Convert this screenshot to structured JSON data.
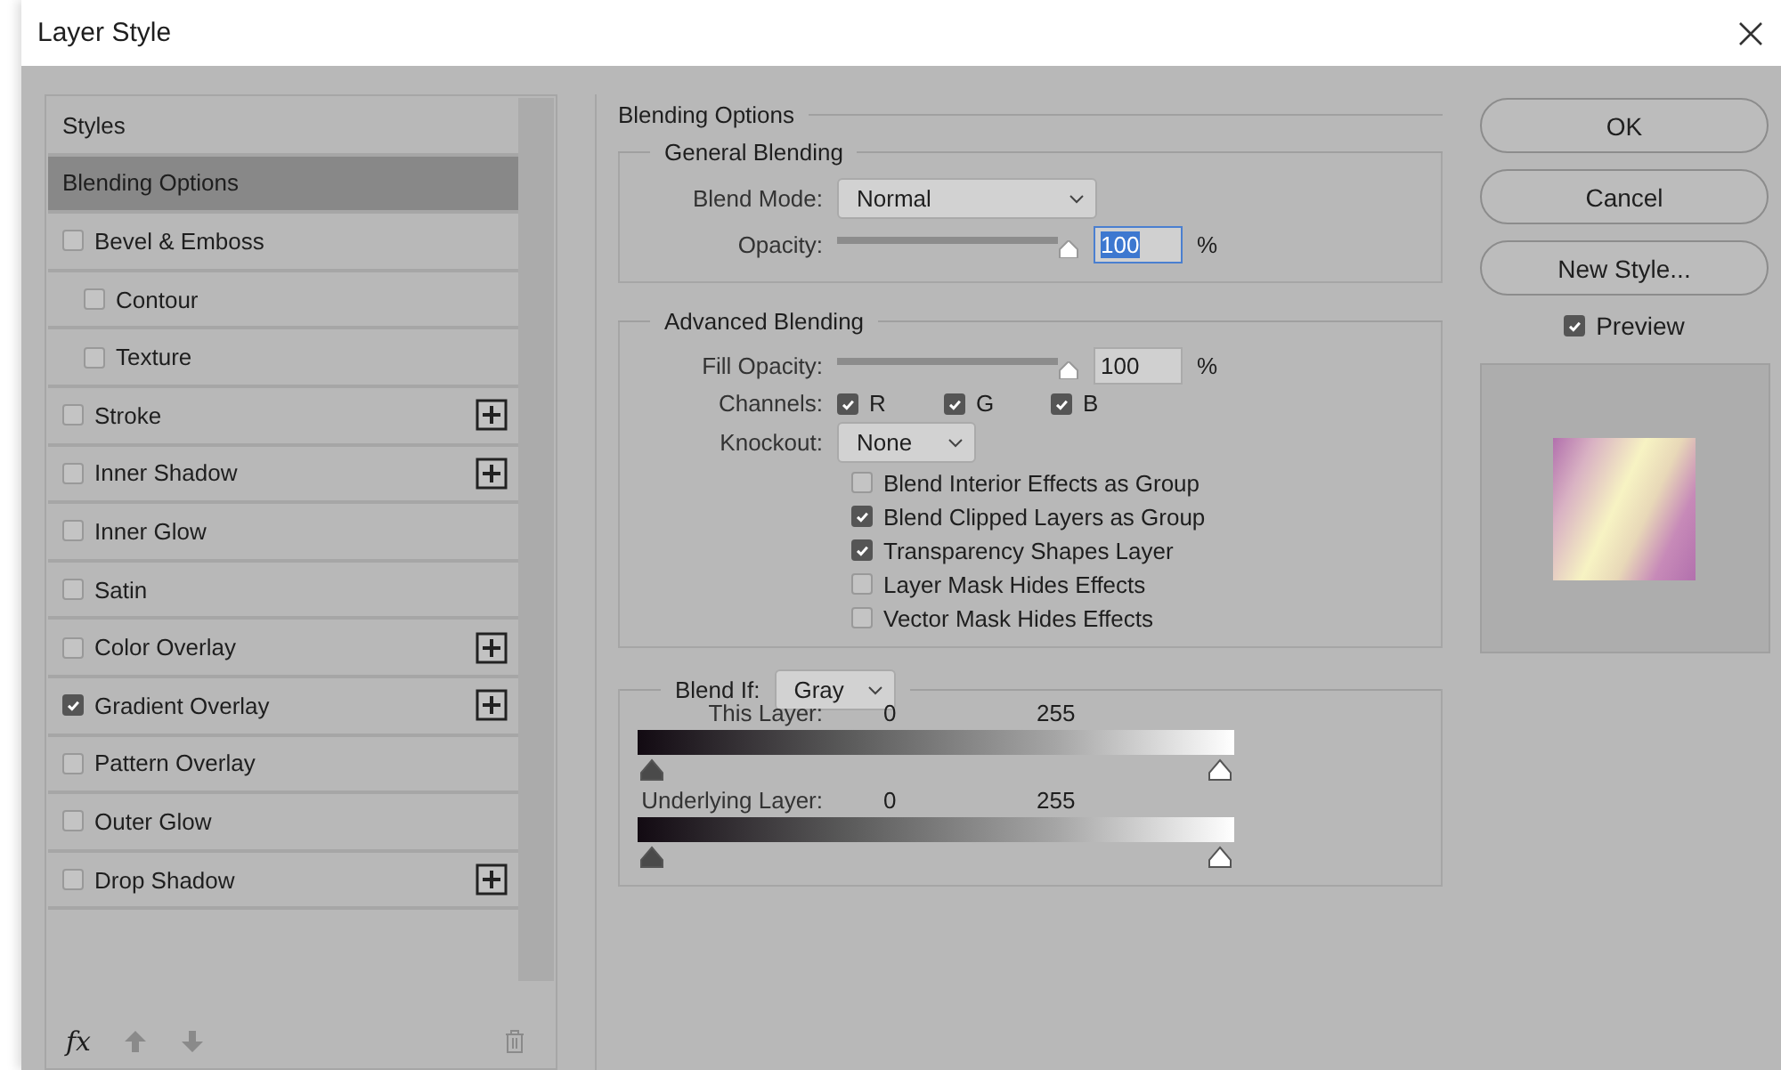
{
  "window": {
    "title": "Layer Style"
  },
  "sidebar": {
    "items": [
      {
        "label": "Styles",
        "kind": "header",
        "selected": false
      },
      {
        "label": "Blending Options",
        "kind": "header",
        "selected": true
      },
      {
        "label": "Bevel & Emboss",
        "kind": "effect",
        "checked": false,
        "selected": false,
        "add_button": false,
        "children": [
          {
            "label": "Contour",
            "kind": "effect",
            "checked": false,
            "selected": false,
            "add_button": false
          },
          {
            "label": "Texture",
            "kind": "effect",
            "checked": false,
            "selected": false,
            "add_button": false
          }
        ]
      },
      {
        "label": "Stroke",
        "kind": "effect",
        "checked": false,
        "selected": false,
        "add_button": true
      },
      {
        "label": "Inner Shadow",
        "kind": "effect",
        "checked": false,
        "selected": false,
        "add_button": true
      },
      {
        "label": "Inner Glow",
        "kind": "effect",
        "checked": false,
        "selected": false,
        "add_button": false
      },
      {
        "label": "Satin",
        "kind": "effect",
        "checked": false,
        "selected": false,
        "add_button": false
      },
      {
        "label": "Color Overlay",
        "kind": "effect",
        "checked": false,
        "selected": false,
        "add_button": true
      },
      {
        "label": "Gradient Overlay",
        "kind": "effect",
        "checked": true,
        "selected": false,
        "add_button": true
      },
      {
        "label": "Pattern Overlay",
        "kind": "effect",
        "checked": false,
        "selected": false,
        "add_button": false
      },
      {
        "label": "Outer Glow",
        "kind": "effect",
        "checked": false,
        "selected": false,
        "add_button": false
      },
      {
        "label": "Drop Shadow",
        "kind": "effect",
        "checked": false,
        "selected": false,
        "add_button": true
      }
    ],
    "footer": {
      "fx": "fx"
    }
  },
  "blending_options": {
    "title": "Blending Options",
    "general": {
      "title": "General Blending",
      "blend_mode_label": "Blend Mode:",
      "blend_mode": "Normal",
      "opacity_label": "Opacity:",
      "opacity": {
        "level": 1,
        "value": "100",
        "unit": "%"
      }
    },
    "advanced": {
      "title": "Advanced Blending",
      "fill_label": "Fill Opacity:",
      "fill": {
        "level": 1,
        "value": "100",
        "unit": "%"
      },
      "channels_label": "Channels:",
      "channels": [
        {
          "label": "R",
          "checked": true
        },
        {
          "label": "G",
          "checked": true
        },
        {
          "label": "B",
          "checked": true
        }
      ],
      "knockout_label": "Knockout:",
      "knockout": "None",
      "options": [
        {
          "label": "Blend Interior Effects as Group",
          "checked": false
        },
        {
          "label": "Blend Clipped Layers as Group",
          "checked": true
        },
        {
          "label": "Transparency Shapes Layer",
          "checked": true
        },
        {
          "label": "Layer Mask Hides Effects",
          "checked": false
        },
        {
          "label": "Vector Mask Hides Effects",
          "checked": false
        }
      ]
    },
    "blend_if": {
      "label": "Blend If:",
      "value": "Gray",
      "ramps": [
        {
          "label": "This Layer:",
          "low": "0",
          "high": "255"
        },
        {
          "label": "Underlying Layer:",
          "low": "0",
          "high": "255"
        }
      ]
    }
  },
  "buttons": [
    {
      "label": "OK"
    },
    {
      "label": "Cancel"
    },
    {
      "label": "New Style..."
    }
  ],
  "preview": {
    "label": "Preview",
    "checked": true
  }
}
